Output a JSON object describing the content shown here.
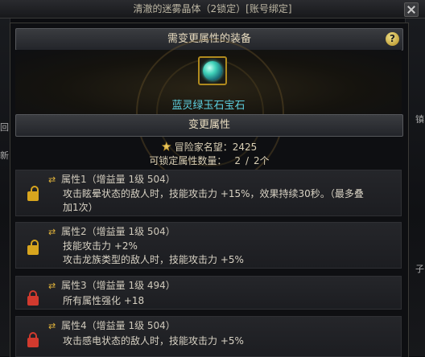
{
  "window": {
    "title": "清澈的迷雾晶体（2锁定）[账号绑定]"
  },
  "background": {
    "left_chars": [
      "回",
      "新"
    ],
    "right_chars": [
      "镇",
      "子"
    ]
  },
  "equipment_section": {
    "header": "需变更属性的装备",
    "help_label": "?",
    "item_name": "蓝灵绿玉石宝石"
  },
  "change_section": {
    "header": "变更属性",
    "fame_label": "冒险家名望：",
    "fame_value": "2425",
    "lockable_label": "可锁定属性数量：",
    "lockable_current": "2",
    "lockable_max": "2个"
  },
  "attributes": [
    {
      "title": "属性1（增益量 1级 504）",
      "lock": "locked",
      "lines": [
        "攻击眩晕状态的敌人时，技能攻击力 +15%，效果持续30秒。（最多叠",
        "加1次）"
      ]
    },
    {
      "title": "属性2（增益量 1级 504）",
      "lock": "locked",
      "lines": [
        "技能攻击力 +2%",
        "攻击龙族类型的敌人时，技能攻击力 +5%"
      ]
    },
    {
      "title": "属性3（增益量 1级 494）",
      "lock": "unlocked",
      "lines": [
        "所有属性强化 +18"
      ]
    },
    {
      "title": "属性4（增益量 1级 504）",
      "lock": "unlocked",
      "lines": [
        "攻击感电状态的敌人时，技能攻击力 +5%"
      ]
    }
  ],
  "colors": {
    "item_name": "#5dd0e0",
    "lock_locked": "#d8a51e",
    "lock_unlocked": "#d13a2e"
  }
}
